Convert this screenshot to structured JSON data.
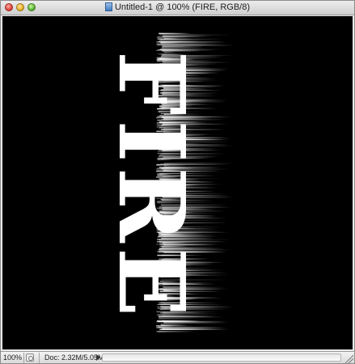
{
  "window": {
    "title": "Untitled-1 @ 100% (FIRE, RGB/8)"
  },
  "canvas": {
    "background": "#000000",
    "text": "FIRE",
    "text_color": "#ffffff"
  },
  "statusbar": {
    "zoom": "100%",
    "doc_size": "Doc: 2.32M/5.05M"
  }
}
